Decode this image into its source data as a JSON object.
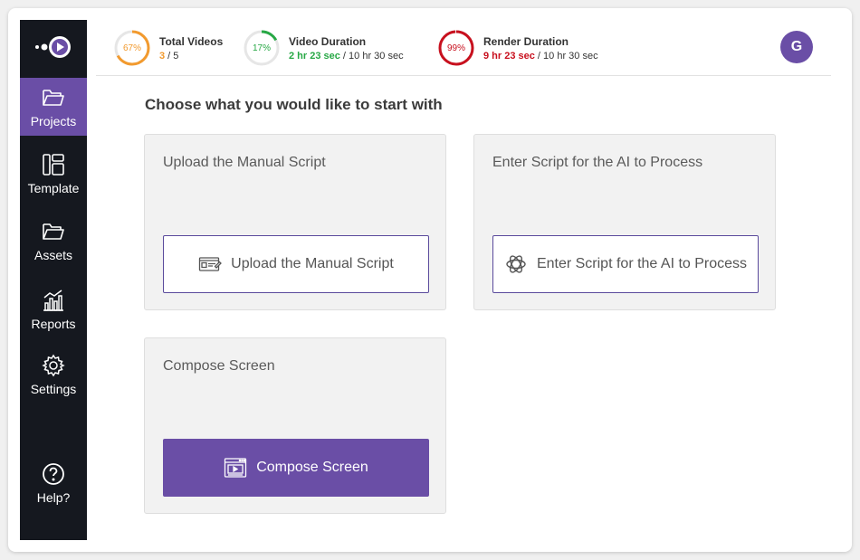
{
  "nav": {
    "logo_icon": "logo-icon",
    "items": [
      {
        "label": "Projects",
        "icon": "folder-open-icon",
        "active": true
      },
      {
        "label": "Template",
        "icon": "layout-icon",
        "active": false
      },
      {
        "label": "Assets",
        "icon": "folder-icon",
        "active": false
      },
      {
        "label": "Reports",
        "icon": "bar-chart-icon",
        "active": false
      },
      {
        "label": "Settings",
        "icon": "gear-icon",
        "active": false
      }
    ],
    "help": {
      "label": "Help?",
      "icon": "help-icon"
    }
  },
  "stats": [
    {
      "percent": "67%",
      "fraction": 0.67,
      "color": "#f29a2e",
      "label": "Total Videos",
      "highlight": "3",
      "rest": " / 5"
    },
    {
      "percent": "17%",
      "fraction": 0.17,
      "color": "#27a845",
      "label": "Video Duration",
      "highlight": "2 hr 23 sec",
      "rest": " / 10 hr 30 sec"
    },
    {
      "percent": "99%",
      "fraction": 0.99,
      "color": "#c8101e",
      "label": "Render Duration",
      "highlight": "9 hr 23 sec",
      "rest": " / 10 hr 30 sec"
    }
  ],
  "user": {
    "initial": "G",
    "color": "#6a4ea6"
  },
  "main": {
    "heading": "Choose what you would like to start with",
    "cards": [
      {
        "title": "Upload the Manual Script",
        "button": "Upload the Manual Script",
        "icon": "script-icon",
        "primary": false
      },
      {
        "title": "Enter Script for the AI to Process",
        "button": "Enter Script for the AI to Process",
        "icon": "ai-icon",
        "primary": false
      },
      {
        "title": "Compose Screen",
        "button": "Compose Screen",
        "icon": "screen-icon",
        "primary": true
      }
    ]
  }
}
